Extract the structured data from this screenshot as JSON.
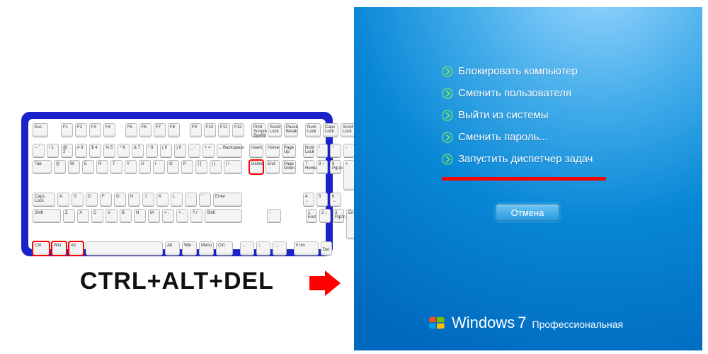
{
  "caption": "CTRL+ALT+DEL",
  "keyboard": {
    "row_fn": [
      "Esc",
      "F1",
      "F2",
      "F3",
      "F4",
      "F5",
      "F6",
      "F7",
      "F8",
      "F9",
      "F10",
      "F11",
      "F12",
      "Print Screen SysRq",
      "Scroll Lock",
      "Pause Break",
      "Num Lock",
      "Caps Lock",
      "Scroll Lock"
    ],
    "row1_main": [
      "~ `",
      "! 1",
      "@ 2",
      "# 3",
      "$ 4",
      "% 5",
      "^ 6",
      "& 7",
      "* 8",
      "( 9",
      ") 0",
      "_ -",
      "+ =",
      "←Backspace"
    ],
    "row1_nav": [
      "Insert",
      "Home",
      "Page Up"
    ],
    "row1_num": [
      "Num Lock",
      "/",
      "*",
      "-"
    ],
    "row2_main": [
      "Tab",
      "Q",
      "W",
      "E",
      "R",
      "T",
      "Y",
      "U",
      "I",
      "O",
      "P",
      "{ [",
      "} ]",
      "| \\"
    ],
    "row2_nav": [
      "Delete",
      "End",
      "Page Down"
    ],
    "row2_num": [
      "7 Home",
      "8 ↑",
      "9 PgUp",
      "+"
    ],
    "row3_main": [
      "Caps Lock",
      "A",
      "S",
      "D",
      "F",
      "G",
      "H",
      "J",
      "K",
      "L",
      ": ;",
      "\" '",
      "Enter"
    ],
    "row3_num": [
      "4 ←",
      "5",
      "6 →"
    ],
    "row4_main": [
      "Shift",
      "Z",
      "X",
      "C",
      "V",
      "B",
      "N",
      "M",
      "< ,",
      "> .",
      "? /",
      "Shift"
    ],
    "row4_nav": [
      "↑"
    ],
    "row4_num": [
      "1 End",
      "2 ↓",
      "3 PgDn",
      "Enter"
    ],
    "row5_main": [
      "Ctrl",
      "Win",
      "Alt",
      "",
      "Alt",
      "Win",
      "Menu",
      "Ctrl"
    ],
    "row5_nav": [
      "←",
      "↓",
      "→"
    ],
    "row5_num": [
      "0 Ins",
      ". Del"
    ],
    "highlighted": [
      "Ctrl",
      "Win",
      "Alt",
      "Delete"
    ]
  },
  "menu": {
    "items": [
      "Блокировать компьютер",
      "Сменить пользователя",
      "Выйти из системы",
      "Сменить пароль...",
      "Запустить диспетчер задач"
    ]
  },
  "cancel_label": "Отмена",
  "branding": {
    "windows": "Windows",
    "seven": "7",
    "edition": "Профессиональная"
  }
}
